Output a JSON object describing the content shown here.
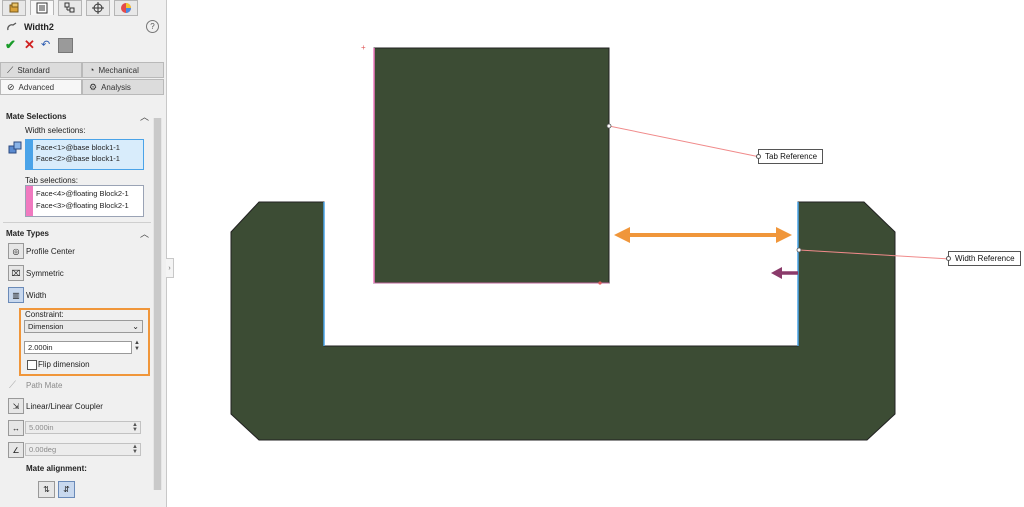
{
  "property_manager": {
    "title": "Width2",
    "help_icon": "help-icon",
    "top_tabs": [
      "featuremanager-icon",
      "propertymanager-icon",
      "configurationmanager-icon",
      "dimxpert-icon",
      "display-manager-icon"
    ],
    "actions": [
      "ok-check-icon",
      "cancel-x-icon",
      "undo-icon",
      "pushpin-icon"
    ],
    "tabs": {
      "standard": "Standard",
      "mechanical": "Mechanical",
      "advanced": "Advanced",
      "analysis": "Analysis"
    },
    "mate_selections": {
      "title": "Mate Selections",
      "width_label": "Width selections:",
      "width_items": [
        "Face<1>@base block1-1",
        "Face<2>@base block1-1"
      ],
      "tab_label": "Tab selections:",
      "tab_items": [
        "Face<4>@floating Block2-1",
        "Face<3>@floating Block2-1"
      ]
    },
    "mate_types": {
      "title": "Mate Types",
      "profile_center": "Profile Center",
      "symmetric": "Symmetric",
      "width": "Width",
      "constraint_label": "Constraint:",
      "constraint_value": "Dimension",
      "dimension_value": "2.000in",
      "flip_dimension": "Flip dimension",
      "path_mate": "Path Mate",
      "linear_coupler": "Linear/Linear Coupler",
      "distance_value": "5.000in",
      "angle_value": "0.00deg",
      "mate_alignment": "Mate alignment:"
    },
    "colors": {
      "width_strip": "#4aa3e8",
      "tab_strip": "#f07ac0",
      "highlight_box": "#f0963a"
    }
  },
  "viewport": {
    "tab_reference": "Tab Reference",
    "width_reference": "Width Reference",
    "colors": {
      "part_fill": "#3c4c34",
      "arrow_orange": "#f0963a",
      "arrow_purple": "#8a3a6a",
      "leader_line": "#f08a8a",
      "width_edge": "#4aa3e8",
      "tab_edge": "#f07ac0"
    }
  }
}
